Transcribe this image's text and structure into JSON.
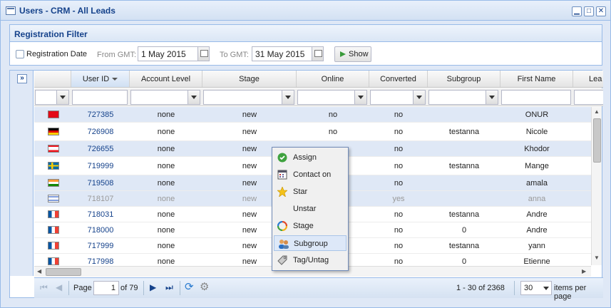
{
  "window": {
    "title": "Users - CRM - All Leads"
  },
  "filter": {
    "title": "Registration Filter",
    "checkbox_label": "Registration Date",
    "from_label": "From GMT:",
    "from_value": "1 May 2015",
    "to_label": "To GMT:",
    "to_value": "31 May 2015",
    "show_label": "Show"
  },
  "grid": {
    "columns": [
      "User ID",
      "Account Level",
      "Stage",
      "Online",
      "Converted",
      "Subgroup",
      "First Name",
      "Lea"
    ],
    "rows": [
      {
        "flag": "turkey-flag",
        "user_id": "727385",
        "account_level": "none",
        "stage": "new",
        "online": "no",
        "converted": "no",
        "subgroup": "",
        "first_name": "ONUR",
        "selected": true,
        "dim": false
      },
      {
        "flag": "germany-flag",
        "user_id": "726908",
        "account_level": "none",
        "stage": "new",
        "online": "no",
        "converted": "no",
        "subgroup": "testanna",
        "first_name": "Nicole",
        "selected": false,
        "dim": false
      },
      {
        "flag": "lebanon-flag",
        "user_id": "726655",
        "account_level": "none",
        "stage": "new",
        "online": "",
        "converted": "no",
        "subgroup": "",
        "first_name": "Khodor",
        "selected": true,
        "dim": false
      },
      {
        "flag": "sweden-flag",
        "user_id": "719999",
        "account_level": "none",
        "stage": "new",
        "online": "",
        "converted": "no",
        "subgroup": "testanna",
        "first_name": "Mange",
        "selected": false,
        "dim": false
      },
      {
        "flag": "india-flag",
        "user_id": "719508",
        "account_level": "none",
        "stage": "new",
        "online": "",
        "converted": "no",
        "subgroup": "",
        "first_name": "amala",
        "selected": true,
        "dim": false
      },
      {
        "flag": "israel-flag",
        "user_id": "718107",
        "account_level": "none",
        "stage": "new",
        "online": "",
        "converted": "yes",
        "subgroup": "",
        "first_name": "anna",
        "selected": true,
        "dim": true
      },
      {
        "flag": "france-flag",
        "user_id": "718031",
        "account_level": "none",
        "stage": "new",
        "online": "",
        "converted": "no",
        "subgroup": "testanna",
        "first_name": "Andre",
        "selected": false,
        "dim": false
      },
      {
        "flag": "france-flag",
        "user_id": "718000",
        "account_level": "none",
        "stage": "new",
        "online": "",
        "converted": "no",
        "subgroup": "0",
        "first_name": "Andre",
        "selected": false,
        "dim": false
      },
      {
        "flag": "france-flag",
        "user_id": "717999",
        "account_level": "none",
        "stage": "new",
        "online": "",
        "converted": "no",
        "subgroup": "testanna",
        "first_name": "yann",
        "selected": false,
        "dim": false
      },
      {
        "flag": "france-flag",
        "user_id": "717998",
        "account_level": "none",
        "stage": "new",
        "online": "",
        "converted": "no",
        "subgroup": "0",
        "first_name": "Etienne",
        "selected": false,
        "dim": false
      }
    ]
  },
  "context_menu": {
    "items": [
      {
        "label": "Assign",
        "icon": "check-circle-icon"
      },
      {
        "label": "Contact on",
        "icon": "calendar-icon"
      },
      {
        "label": "Star",
        "icon": "star-icon"
      },
      {
        "label": "Unstar",
        "icon": ""
      },
      {
        "label": "Stage",
        "icon": "cycle-icon"
      },
      {
        "label": "Subgroup",
        "icon": "users-icon"
      },
      {
        "label": "Tag/Untag",
        "icon": "tag-icon"
      }
    ],
    "hovered": "Subgroup"
  },
  "pager": {
    "page_label": "Page",
    "page_value": "1",
    "of_label": "of 79",
    "range_text": "1 - 30 of 2368",
    "per_page_value": "30",
    "per_page_label": "items per page"
  },
  "colors": {
    "accent": "#15428b",
    "border": "#99bbe8",
    "selected_row": "#dfe8f6"
  }
}
